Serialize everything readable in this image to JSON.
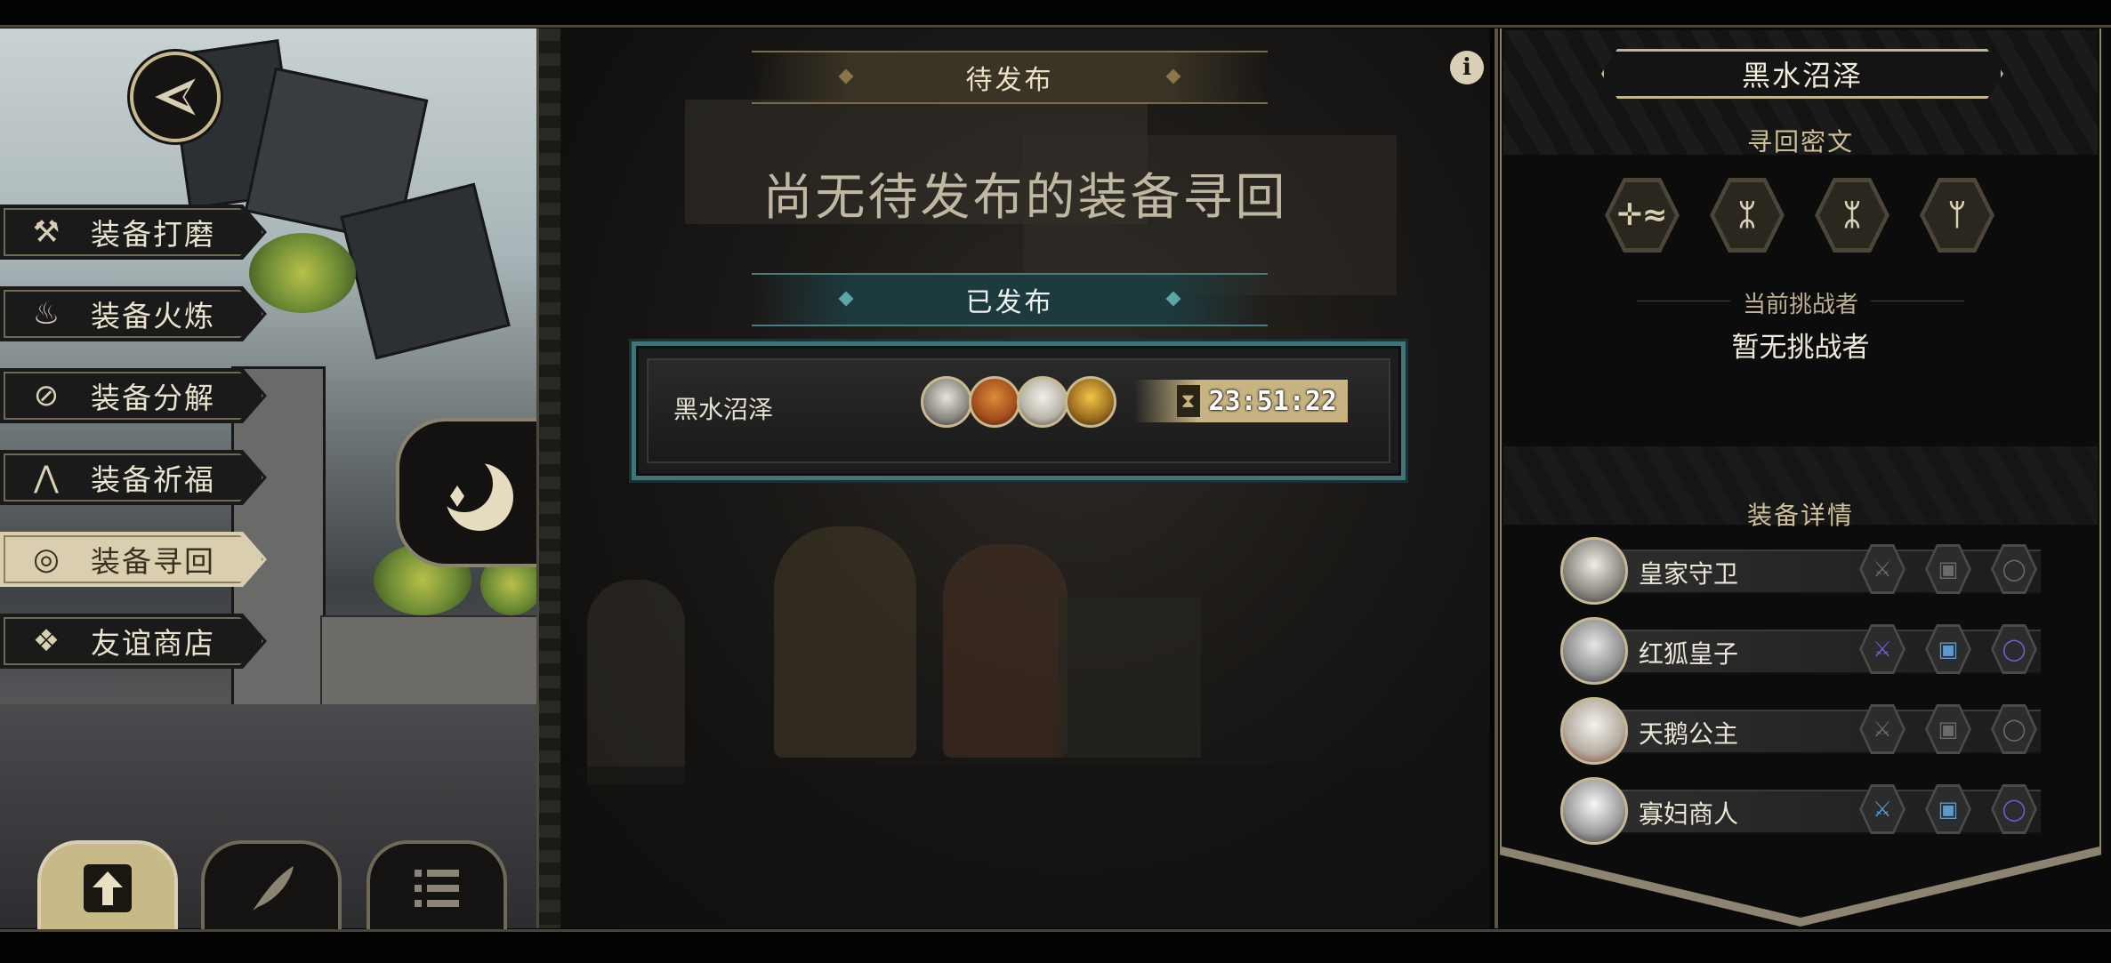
{
  "left_menu": {
    "items": [
      {
        "label": "装备打磨",
        "icon": "hammer-icon",
        "active": false
      },
      {
        "label": "装备火炼",
        "icon": "flame-icon",
        "active": false
      },
      {
        "label": "装备分解",
        "icon": "disassemble-icon",
        "active": false
      },
      {
        "label": "装备祈福",
        "icon": "prayer-hands-icon",
        "active": false
      },
      {
        "label": "装备寻回",
        "icon": "target-icon",
        "active": true
      },
      {
        "label": "友谊商店",
        "icon": "fox-head-icon",
        "active": false
      }
    ],
    "bottom_buttons": [
      {
        "icon": "upload-icon",
        "active": true
      },
      {
        "icon": "feather-icon",
        "active": false
      },
      {
        "icon": "list-icon",
        "active": false
      }
    ]
  },
  "center": {
    "pending_header": "待发布",
    "empty_message": "尚无待发布的装备寻回",
    "published_header": "已发布",
    "bounty": {
      "region": "黑水沼泽",
      "timer": "23:51:22",
      "portraits": [
        "knight-portrait",
        "fox-portrait",
        "swan-portrait",
        "rooster-portrait"
      ]
    }
  },
  "right_panel": {
    "region_title": "黑水沼泽",
    "cipher_title": "寻回密文",
    "runes": [
      "✛≈",
      "ᛯ",
      "ᛯ",
      "ᛘ"
    ],
    "challenger_label": "当前挑战者",
    "challenger_value": "暂无挑战者",
    "equipment_title": "装备详情",
    "equipment": [
      {
        "name": "皇家守卫",
        "weapon": "gray",
        "armor": "gray",
        "ring": "gray"
      },
      {
        "name": "红狐皇子",
        "weapon": "purple",
        "armor": "blue",
        "ring": "purple"
      },
      {
        "name": "天鹅公主",
        "weapon": "gray",
        "armor": "gray",
        "ring": "gray"
      },
      {
        "name": "寡妇商人",
        "weapon": "blue",
        "armor": "blue",
        "ring": "purple"
      }
    ]
  },
  "colors": {
    "gold": "#c9b98e",
    "teal_accent": "#3f7478",
    "gray_slot": "#6b6b6b",
    "blue_slot": "#5a9ad0",
    "purple_slot": "#7a5ad6"
  }
}
